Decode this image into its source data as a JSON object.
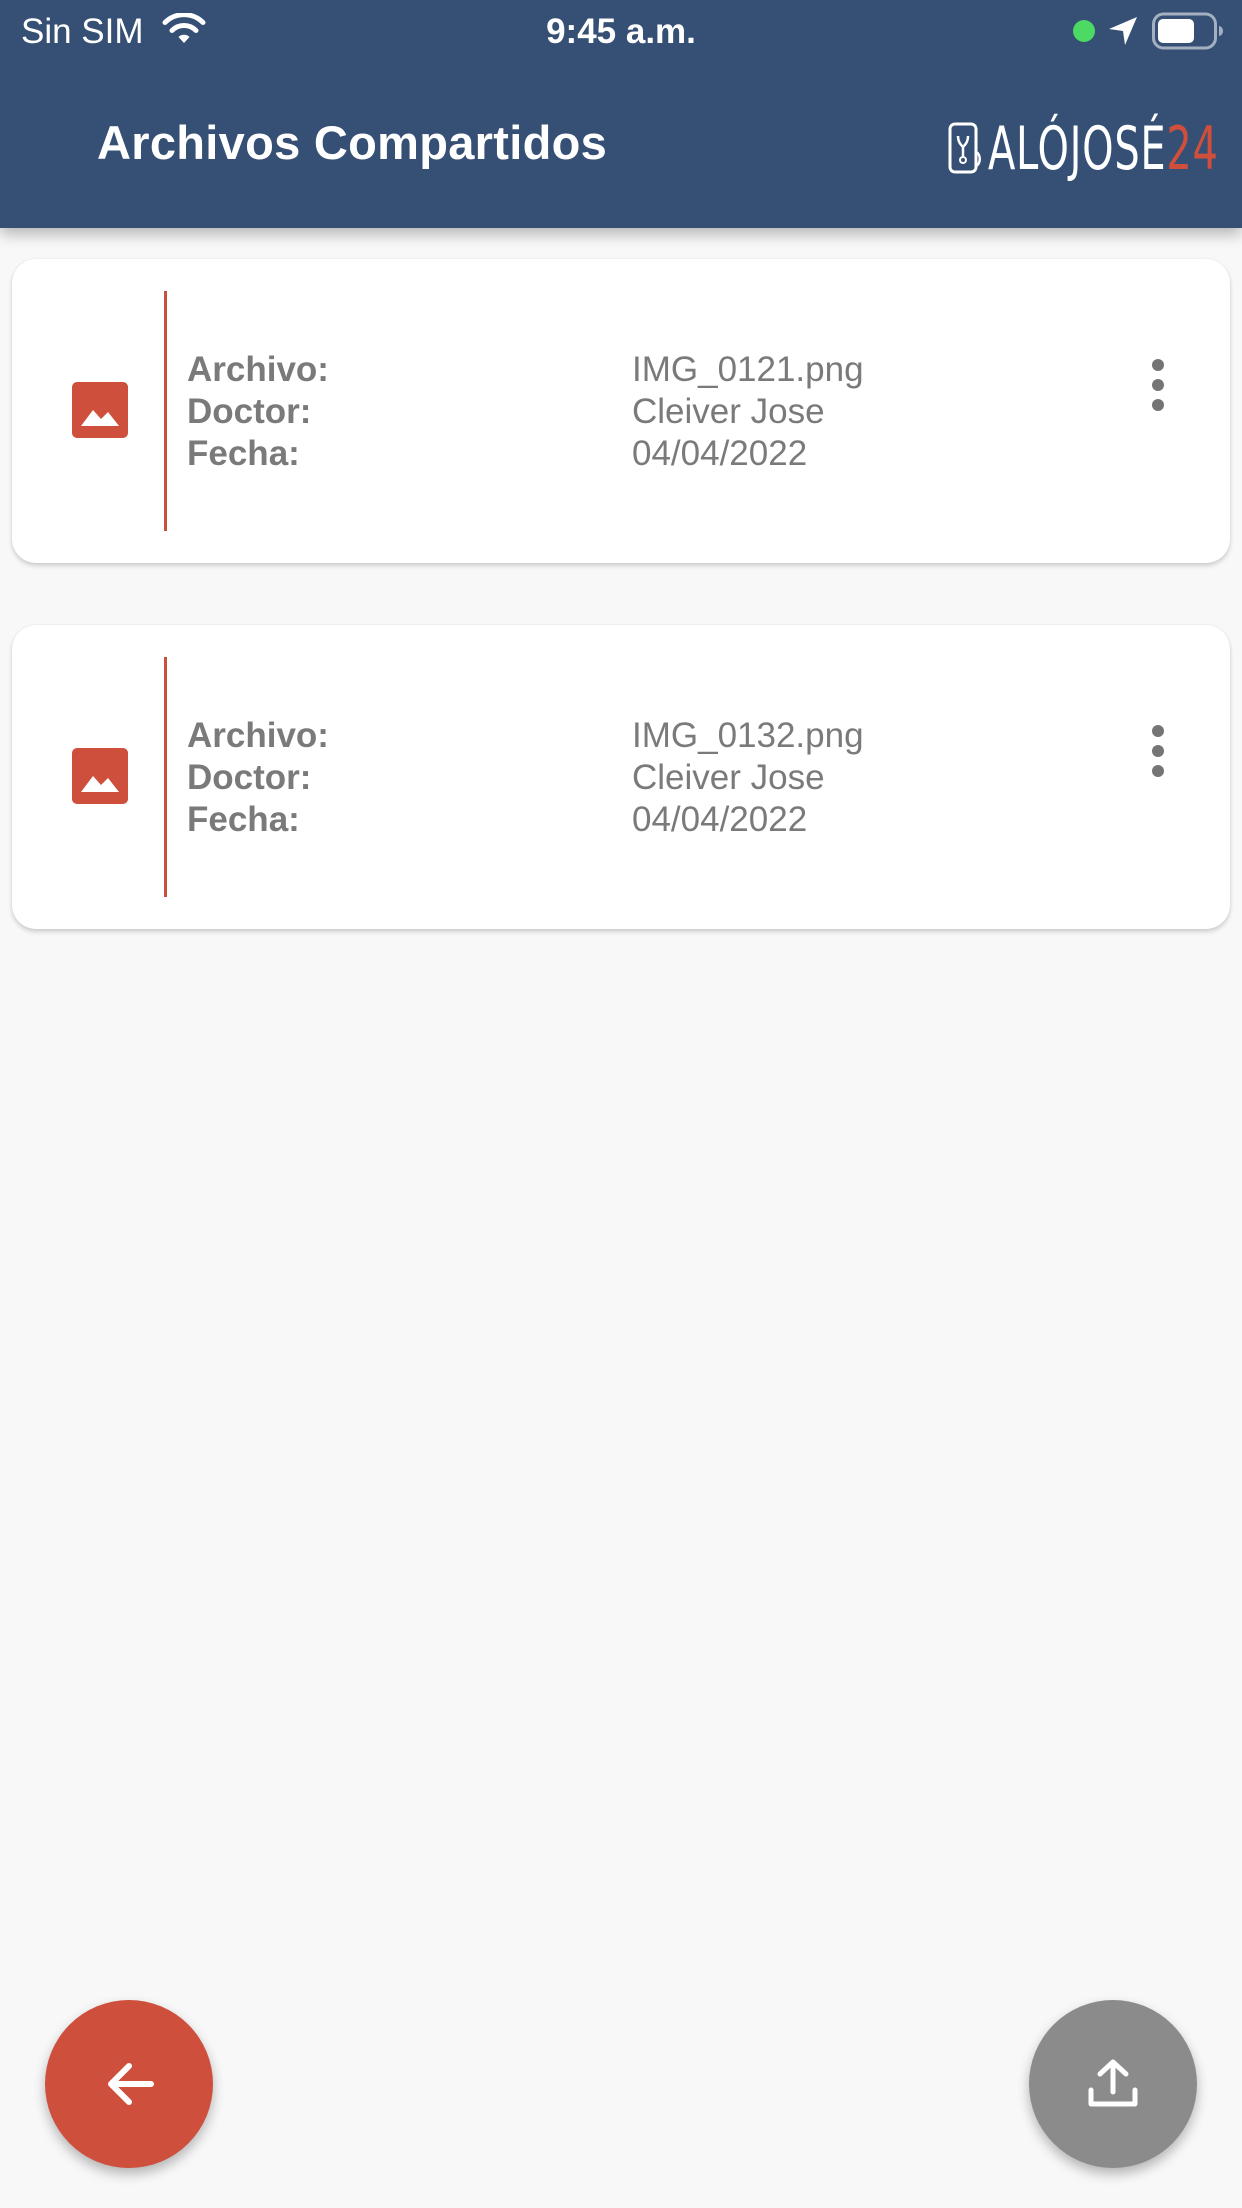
{
  "status_bar": {
    "carrier": "Sin SIM",
    "time": "9:45 a.m.",
    "icons": [
      "wifi-icon",
      "location-icon",
      "battery-icon"
    ]
  },
  "header": {
    "title": "Archivos Compartidos",
    "logo": {
      "text_main": "ALÓJOSÉ",
      "text_accent": "24"
    }
  },
  "files": [
    {
      "icon": "image-icon",
      "archivo_label": "Archivo:",
      "archivo": "IMG_0121.png",
      "doctor_label": "Doctor:",
      "doctor": "Cleiver Jose",
      "fecha_label": "Fecha:",
      "fecha": "04/04/2022"
    },
    {
      "icon": "image-icon",
      "archivo_label": "Archivo:",
      "archivo": "IMG_0132.png",
      "doctor_label": "Doctor:",
      "doctor": "Cleiver Jose",
      "fecha_label": "Fecha:",
      "fecha": "04/04/2022"
    }
  ],
  "actions": {
    "back_icon": "arrow-left-icon",
    "upload_icon": "upload-icon"
  },
  "colors": {
    "header_bg": "#355074",
    "accent": "#cd4f3c",
    "upload_fab": "#8b8b8b",
    "background": "#f8f8f8",
    "text_muted": "#7a7a7a"
  }
}
